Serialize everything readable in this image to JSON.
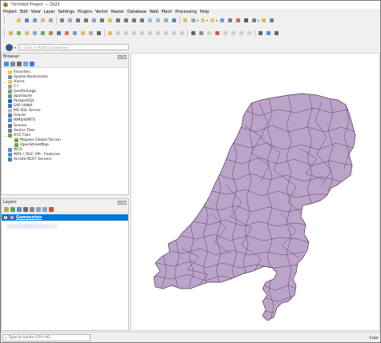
{
  "window": {
    "title": "*Untitled Project — QGIS"
  },
  "menu": [
    "Project",
    "Edit",
    "View",
    "Layer",
    "Settings",
    "Plugins",
    "Vector",
    "Raster",
    "Database",
    "Web",
    "Mesh",
    "Processing",
    "Help"
  ],
  "search": {
    "value": "Zoek in PDOK Locatieserver"
  },
  "browser": {
    "title": "Browser",
    "items": [
      {
        "label": "Favorites",
        "icon": "star-icon",
        "color": "#f4c542",
        "arrow": "",
        "indent": 0
      },
      {
        "label": "Spatial Bookmarks",
        "icon": "bookmark-icon",
        "color": "#6b8cc7",
        "arrow": "›",
        "indent": 0
      },
      {
        "label": "Home",
        "icon": "folder-icon",
        "color": "#e8c05a",
        "arrow": "›",
        "indent": 0
      },
      {
        "label": "C:\\",
        "icon": "drive-icon",
        "color": "#9aa0a6",
        "arrow": "›",
        "indent": 0
      },
      {
        "label": "GeoPackage",
        "icon": "geopackage-icon",
        "color": "#7aa66b",
        "arrow": "",
        "indent": 0
      },
      {
        "label": "SpatiaLite",
        "icon": "spatialite-icon",
        "color": "#5e8fbf",
        "arrow": "",
        "indent": 0
      },
      {
        "label": "PostgreSQL",
        "icon": "postgresql-icon",
        "color": "#336791",
        "arrow": "",
        "indent": 0
      },
      {
        "label": "SAP HANA",
        "icon": "sap-hana-icon",
        "color": "#2b76c8",
        "arrow": "",
        "indent": 0
      },
      {
        "label": "MS SQL Server",
        "icon": "mssql-icon",
        "color": "#b9b9b9",
        "arrow": "",
        "indent": 0
      },
      {
        "label": "Oracle",
        "icon": "oracle-icon",
        "color": "#4a79b9",
        "arrow": "",
        "indent": 0
      },
      {
        "label": "WMS/WMTS",
        "icon": "wms-globe-icon",
        "color": "#4c8fd6",
        "arrow": "",
        "indent": 0
      },
      {
        "label": "Scenes",
        "icon": "scenes-icon",
        "color": "#6d6d6d",
        "arrow": "",
        "indent": 0
      },
      {
        "label": "Vector Tiles",
        "icon": "vector-tiles-icon",
        "color": "#7b7b9a",
        "arrow": "",
        "indent": 0
      },
      {
        "label": "XYZ Tiles",
        "icon": "xyz-tiles-icon",
        "color": "#6aa84f",
        "arrow": "⌄",
        "indent": 0
      },
      {
        "label": "Mapzen Global Terrain",
        "icon": "tile-layer-icon",
        "color": "#6aa84f",
        "arrow": "",
        "indent": 1
      },
      {
        "label": "OpenStreetMap",
        "icon": "tile-layer-icon",
        "color": "#6aa84f",
        "arrow": "",
        "indent": 1
      },
      {
        "label": "WCS",
        "icon": "wcs-globe-icon",
        "color": "#4c8fd6",
        "arrow": "",
        "indent": 0
      },
      {
        "label": "WFS / OGC API - Features",
        "icon": "wfs-globe-icon",
        "color": "#4c8fd6",
        "arrow": "",
        "indent": 0
      },
      {
        "label": "ArcGIS REST Servers",
        "icon": "arcgis-icon",
        "color": "#3b7dd8",
        "arrow": "",
        "indent": 0
      }
    ]
  },
  "layers": {
    "title": "Layers",
    "items": [
      {
        "name": "Gemeenten",
        "checked": true,
        "fill": "#bca3c9"
      }
    ]
  },
  "map": {
    "fill": "#bca3c9",
    "stroke": "#4b3a55"
  },
  "status": {
    "locator_placeholder": "Type to locate (Ctrl+K)",
    "coordinate_label": "Coor"
  },
  "colors": {
    "selection": "#0078d7",
    "panel_bg": "#f0f0f0"
  }
}
